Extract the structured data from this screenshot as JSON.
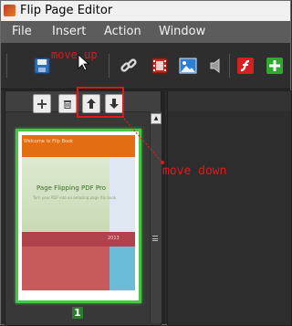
{
  "window": {
    "title": "Flip Page Editor"
  },
  "menu": {
    "items": [
      "File",
      "Insert",
      "Action",
      "Window"
    ]
  },
  "toolbar": {
    "icons": [
      "save-icon",
      "link-icon",
      "video-icon",
      "image-icon",
      "sound-icon",
      "flash-icon",
      "add-icon"
    ]
  },
  "page_panel": {
    "buttons": [
      "add-page",
      "delete-page",
      "move-up",
      "move-down"
    ],
    "thumbnail": {
      "header_text": "Welcome to Flip Book",
      "title": "Page Flipping PDF Pro",
      "subtitle": "Turn your PDF into an amazing page flip book",
      "bar_text": "2013",
      "page_number": "1"
    }
  },
  "annotations": {
    "up": "move up",
    "down": "move down"
  },
  "colors": {
    "annotation": "#e0191b",
    "thumbnail_border": "#46c846",
    "thumbnail_header": "#e26d12"
  }
}
